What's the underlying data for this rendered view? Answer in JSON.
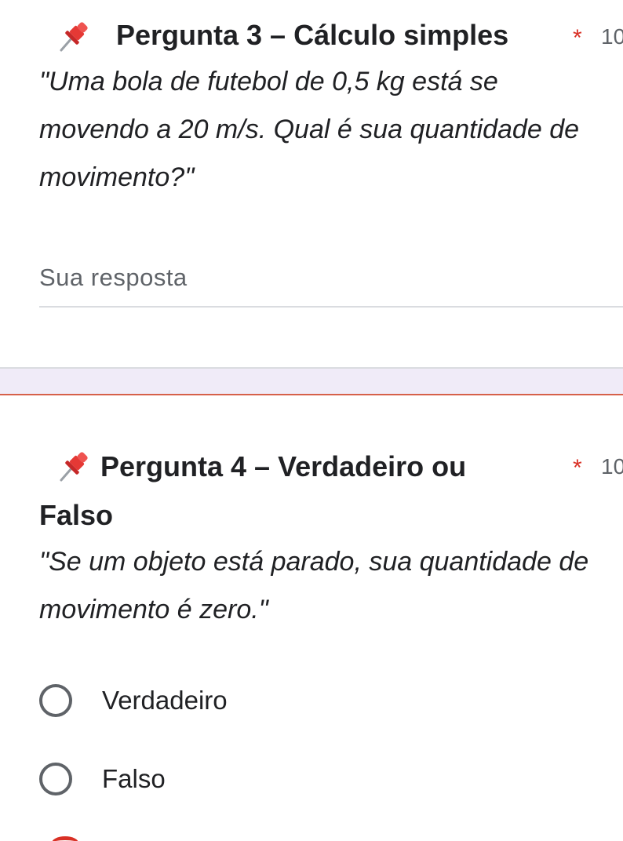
{
  "question3": {
    "title": "Pergunta 3 – Cálculo simples",
    "required_mark": "*",
    "points": "10",
    "description": "\"Uma bola de futebol de 0,5 kg está se movendo a 20 m/s. Qual é sua quantidade de movimento?\"",
    "answer_placeholder": "Sua resposta",
    "icon": "pushpin-icon"
  },
  "question4": {
    "title": "Pergunta 4 – Verdadeiro ou Falso",
    "required_mark": "*",
    "points": "10",
    "description": "\"Se um objeto está parado, sua quantidade de movimento é zero.\"",
    "icon": "pushpin-icon",
    "options": [
      {
        "label": "Verdadeiro",
        "selected": false
      },
      {
        "label": "Falso",
        "selected": false
      }
    ]
  },
  "colors": {
    "required": "#d93025",
    "background_gap": "#f0ebf8",
    "text": "#202124",
    "muted": "#5f6368"
  }
}
